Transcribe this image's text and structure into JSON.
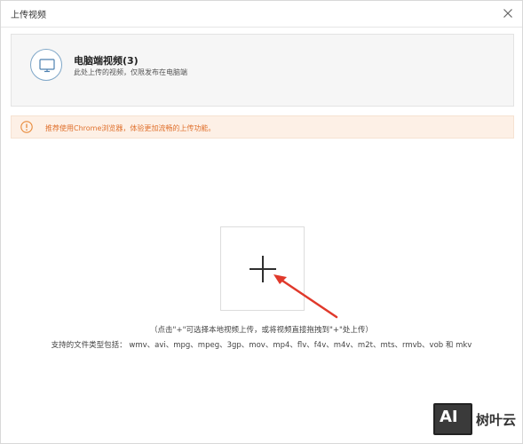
{
  "dialog": {
    "title": "上传视频"
  },
  "option": {
    "title": "电脑端视频(3)",
    "description": "此处上传的视频，仅限发布在电脑端",
    "icon": "monitor-icon"
  },
  "notice": {
    "icon": "warning-icon",
    "text": "推荐使用Chrome浏览器，体验更加流畅的上传功能。"
  },
  "upload": {
    "icon": "plus-icon",
    "hint": "（点击\"+\"可选择本地视频上传，或将视频直接拖拽到\"+\"处上传）",
    "formats": "支持的文件类型包括： wmv、avi、mpg、mpeg、3gp、mov、mp4、flv、f4v、m4v、m2t、mts、rmvb、vob 和 mkv"
  },
  "watermark": {
    "badge": "AI",
    "text": "树叶云"
  },
  "colors": {
    "notice_text": "#e0712d",
    "notice_bg": "#fdf0e6",
    "arrow": "#e0392b",
    "icon_blue": "#7fa7c8"
  }
}
